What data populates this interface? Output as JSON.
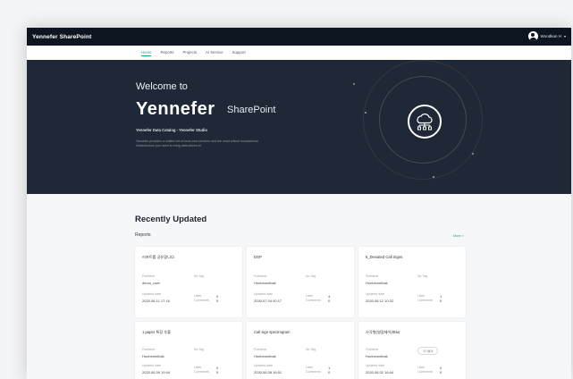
{
  "app": {
    "brand": "Yennefer SharePoint",
    "user_name": "Woodkun H"
  },
  "nav": {
    "items": [
      "Home",
      "Reports",
      "Projects",
      "AI Service",
      "Support"
    ],
    "active": "Home"
  },
  "hero": {
    "welcome": "Welcome to",
    "logo_text": "Yennefer",
    "logo_suffix": "SharePoint",
    "catalog": "Yennefer Data Catalog - Yennefer Studio",
    "description": "Yennefer provides a unified set of tools and services and the most critical foundational infrastructure you need to bring data-driven AI.",
    "icon": "cloud-network-icon"
  },
  "recent": {
    "title": "Recently Updated",
    "section": "Reports",
    "more": "More >",
    "labels": {
      "publisher": "Publisher",
      "updated": "Updated date",
      "likes": "Likes",
      "comments": "Comments"
    },
    "cards": [
      {
        "title": "리포트를 공유합니다.",
        "tag": "No Tag",
        "publisher": "demo_user",
        "updated": "2020.08.11 17:16",
        "likes": "0",
        "comments": "0"
      },
      {
        "title": "DSP",
        "tag": "No Tag",
        "publisher": "Hunbeomlbak",
        "updated": "2020.07.04 00:17",
        "likes": "4",
        "comments": "0"
      },
      {
        "title": "5_Deviated Call Signs",
        "tag": "No Tag",
        "publisher": "Hunbeomlbak",
        "updated": "2020.06.12 10:32",
        "likes": "1",
        "comments": "0"
      },
      {
        "title": "1.paper 특징 추출",
        "tag": "No Tag",
        "publisher": "Hunbeomlbak",
        "updated": "2020.06.09 19:04",
        "likes": "0",
        "comments": "0"
      },
      {
        "title": "Call sign spectrogram",
        "tag": "No Tag",
        "publisher": "Hunbeomlbak",
        "updated": "2020.06.08 16:51",
        "likes": "1",
        "comments": "0"
      },
      {
        "title": "사각형(영점제어)/Blur",
        "tag": "국가통계",
        "publisher": "Hunbeomlbak",
        "updated": "2020.06.02 16:44",
        "likes": "0",
        "comments": "0"
      }
    ]
  }
}
